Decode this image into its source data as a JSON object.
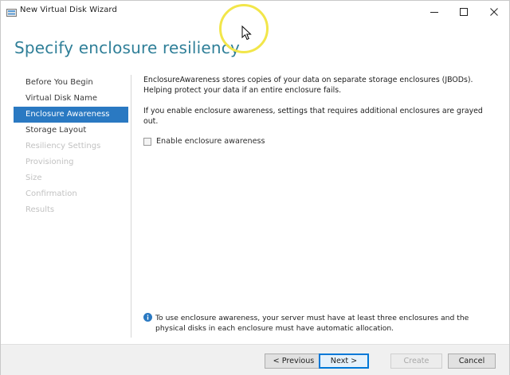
{
  "window": {
    "title": "New Virtual Disk Wizard"
  },
  "header": {
    "title": "Specify enclosure resiliency"
  },
  "nav": {
    "items": [
      {
        "label": "Before You Begin",
        "state": "done"
      },
      {
        "label": "Virtual Disk Name",
        "state": "done"
      },
      {
        "label": "Enclosure Awareness",
        "state": "current"
      },
      {
        "label": "Storage Layout",
        "state": "pending"
      },
      {
        "label": "Resiliency Settings",
        "state": "disabled"
      },
      {
        "label": "Provisioning",
        "state": "disabled"
      },
      {
        "label": "Size",
        "state": "disabled"
      },
      {
        "label": "Confirmation",
        "state": "disabled"
      },
      {
        "label": "Results",
        "state": "disabled"
      }
    ]
  },
  "content": {
    "description_1": "EnclosureAwareness stores copies of your data on separate storage enclosures (JBODs). Helping protect your data if an entire enclosure fails.",
    "description_2": "If you enable enclosure awareness, settings that requires additional enclosures are grayed out.",
    "checkbox_label": "Enable enclosure awareness",
    "checkbox_checked": false,
    "info_text": "To use enclosure awareness, your server must have at least three enclosures and the physical disks in each enclosure must have automatic allocation."
  },
  "buttons": {
    "previous": "< Previous",
    "next": "Next >",
    "create": "Create",
    "cancel": "Cancel"
  },
  "colors": {
    "title_accent": "#2f7f98",
    "nav_selected": "#2a79c2",
    "info_icon": "#2a79c2",
    "cursor_highlight": "#f2e64a"
  },
  "icons": {
    "app": "virtual-disk-icon",
    "minimize": "minimize-icon",
    "maximize": "maximize-icon",
    "close": "close-icon",
    "info": "info-icon",
    "cursor": "cursor-icon"
  }
}
